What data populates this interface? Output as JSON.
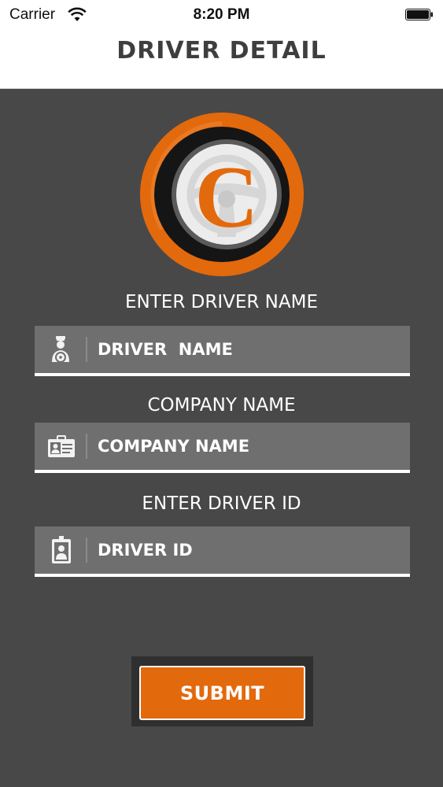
{
  "status_bar": {
    "carrier": "Carrier",
    "time": "8:20 PM",
    "wifi_icon": "wifi-icon",
    "battery_icon": "battery-icon"
  },
  "nav": {
    "title": "DRIVER DETAIL"
  },
  "logo": {
    "letter": "C",
    "icon": "steering-wheel-logo",
    "colors": {
      "ring": "#e3690d",
      "inner": "#1a1a1a",
      "disc": "#eeeeee"
    }
  },
  "form": {
    "driver_name": {
      "label": "ENTER DRIVER NAME",
      "placeholder": "DRIVER  NAME",
      "value": "",
      "icon": "driver-icon"
    },
    "company_name": {
      "label": "COMPANY NAME",
      "placeholder": "COMPANY NAME",
      "value": "",
      "icon": "id-card-icon"
    },
    "driver_id": {
      "label": "ENTER DRIVER ID",
      "placeholder": "DRIVER ID",
      "value": "",
      "icon": "badge-icon"
    },
    "submit_label": "SUBMIT"
  },
  "theme": {
    "accent": "#e3690d",
    "background": "#484848",
    "field_bg": "#6f6f6f"
  }
}
